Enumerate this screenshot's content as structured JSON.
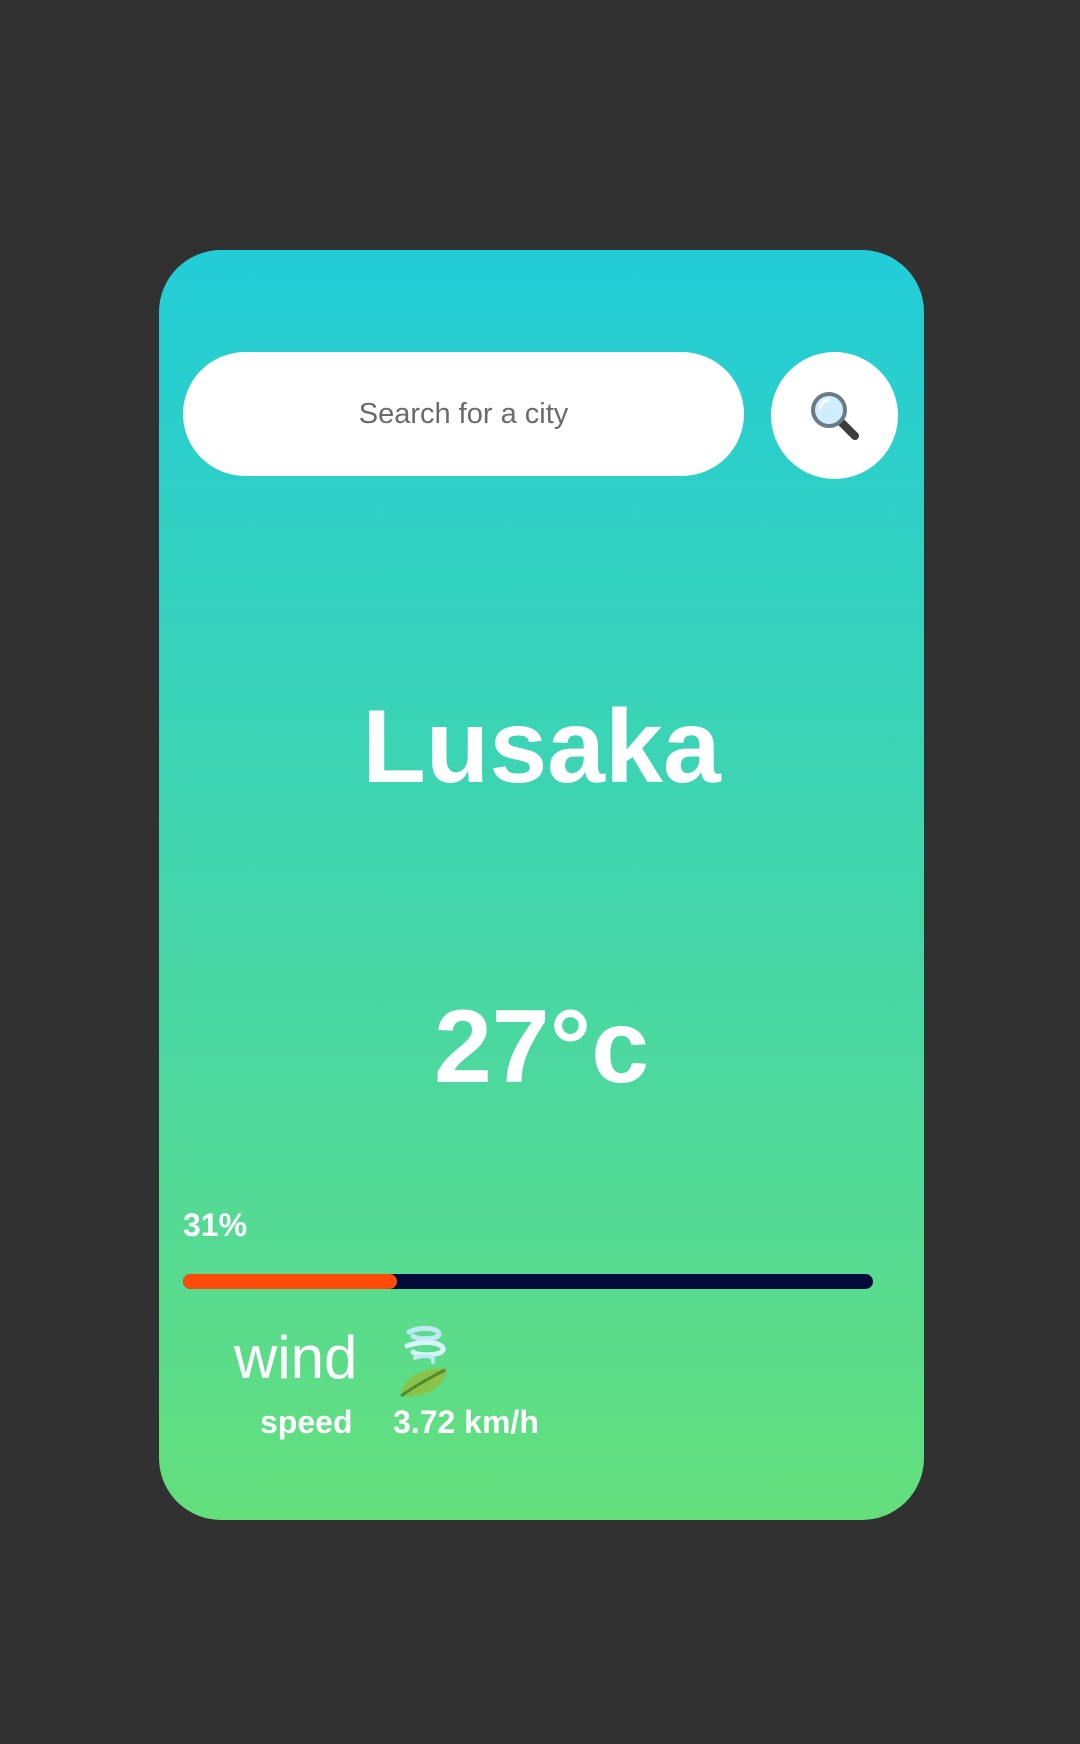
{
  "search": {
    "placeholder": "Search for a city",
    "button_icon": "search-icon"
  },
  "weather": {
    "city": "Lusaka",
    "temperature": "27°c",
    "humidity_label": "31%",
    "humidity_fraction": 0.31,
    "wind_label": "wind",
    "wind_icon": "wind-leaf-icon",
    "speed_label": "speed",
    "speed_value": "3.72 km/h"
  },
  "colors": {
    "page_bg": "#313131",
    "gradient_top": "#22cdd8",
    "gradient_bottom": "#64df7c",
    "bar_fill": "#ff4a0a",
    "bar_track": "#030b3a"
  }
}
